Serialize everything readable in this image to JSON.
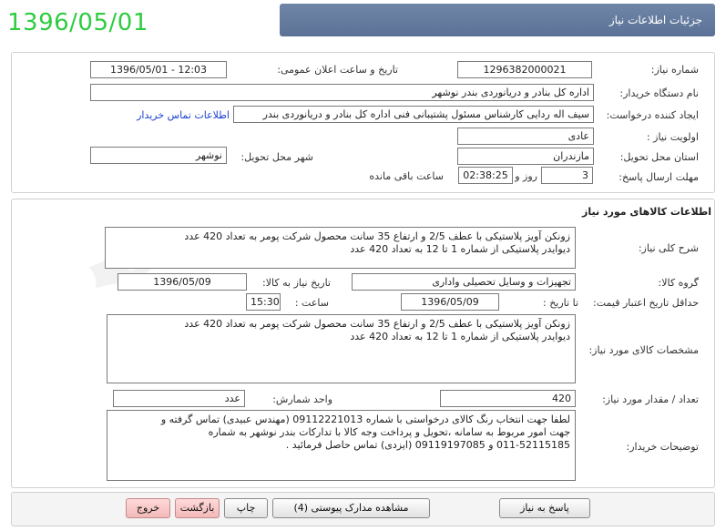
{
  "date_stamp": "1396/05/01",
  "header": {
    "title": "جزئیات اطلاعات نیاز"
  },
  "need_info": {
    "need_number_label": "شماره نیاز:",
    "need_number": "1296382000021",
    "announce_label": "تاریخ و ساعت اعلان عمومی:",
    "announce_value": "1396/05/01 - 12:03",
    "buyer_label": "نام دستگاه خریدار:",
    "buyer_value": "اداره کل بنادر و دریانوردی بندر نوشهر",
    "creator_label": "ایجاد کننده درخواست:",
    "creator_value": "سیف اله ردایی کارشناس مسئول پشتیبانی فنی اداره کل بنادر و دریانوردی بندر",
    "contact_link": "اطلاعات تماس خریدار",
    "priority_label": "اولویت نیاز :",
    "priority_value": "عادی",
    "province_label": "استان محل تحویل:",
    "province_value": "مازندران",
    "city_label": "شهر محل تحویل:",
    "city_value": "نوشهر",
    "deadline_label": "مهلت ارسال پاسخ:",
    "deadline_days": "3",
    "days_and": "روز و",
    "deadline_time": "02:38:25",
    "remaining": "ساعت باقی مانده"
  },
  "goods": {
    "section_title": "اطلاعات کالاهای مورد نیاز",
    "summary_label": "شرح کلی نیاز:",
    "summary_text": "زونکن آویز پلاستیکی با عطف 2/5 و ارتفاع 35 سانت محصول شرکت پومر به تعداد 420 عدد\nدیوایدر پلاستیکی از شماره 1 تا 12   به تعداد 420 عدد",
    "group_label": "گروه کالا:",
    "group_value": "تجهیزات و وسایل تحصیلی واداری",
    "need_date_label": "تاریخ نیاز به کالا:",
    "need_date_value": "1396/05/09",
    "min_price_label": "حداقل تاریخ اعتبار قیمت:",
    "until_date_label": "تا تاریخ :",
    "until_date_value": "1396/05/09",
    "time_label": "ساعت :",
    "time_value": "15:30",
    "specs_label": "مشخصات کالای مورد نیاز:",
    "specs_text": "زونکن آویز پلاستیکی با عطف 2/5 و ارتفاع 35 سانت محصول شرکت پومر به تعداد 420 عدد\nدیوایدر پلاستیکی از شماره 1 تا 12   به تعداد 420 عدد",
    "qty_label": "تعداد / مقدار مورد نیاز:",
    "qty_value": "420",
    "unit_label": "واحد شمارش:",
    "unit_value": "عدد",
    "notes_label": "توضیحات خریدار:",
    "notes_text": "لطفا جهت انتخاب رنگ کالای درخواستی با شماره 09112221013 (مهندس عبیدی) تماس گرفته و\nجهت امور مربوط به سامانه  ،تحویل و پرداخت وجه  کالا با تدارکات بندر نوشهر به شماره\n011-52115185 و 09119197085 (ایزدی) تماس حاصل فرمائید ."
  },
  "buttons": {
    "reply": "پاسخ به نیاز",
    "attachments": "مشاهده مدارک پیوستی (4)",
    "print": "چاپ",
    "back": "بازگشت",
    "exit": "خروج"
  }
}
